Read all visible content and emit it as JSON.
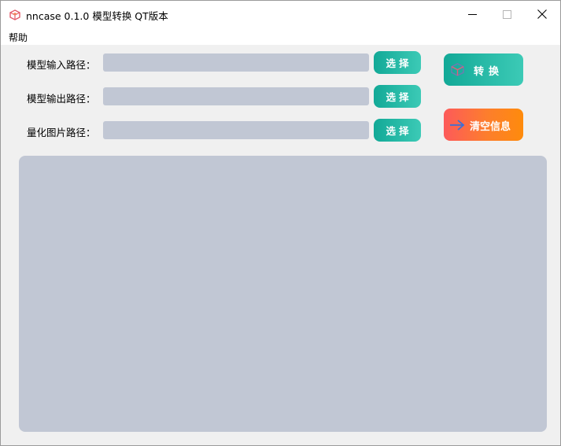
{
  "window": {
    "title": "nncase 0.1.0 模型转换 QT版本",
    "icon": "nncase-cube-icon"
  },
  "window_controls": {
    "minimize": "minimize-icon",
    "maximize": "maximize-icon",
    "close": "close-icon"
  },
  "menu": {
    "items": [
      {
        "label": "帮助"
      }
    ]
  },
  "form": {
    "rows": [
      {
        "label": "模型输入路径：",
        "value": "",
        "button": "选择"
      },
      {
        "label": "模型输出路径：",
        "value": "",
        "button": "选择"
      },
      {
        "label": "量化图片路径：",
        "value": "",
        "button": "选择"
      }
    ]
  },
  "actions": {
    "convert": {
      "label": "转换",
      "icon": "cube-icon"
    },
    "clear": {
      "label": "清空信息",
      "icon": "arrow-right-icon"
    }
  },
  "info": {
    "value": ""
  },
  "colors": {
    "teal_start": "#12a997",
    "teal_end": "#3ccab6",
    "orange_start": "#fd5a5a",
    "orange_end": "#fe8b0c",
    "field_bg": "#c1c7d4",
    "window_bg": "#f0f0f0"
  }
}
